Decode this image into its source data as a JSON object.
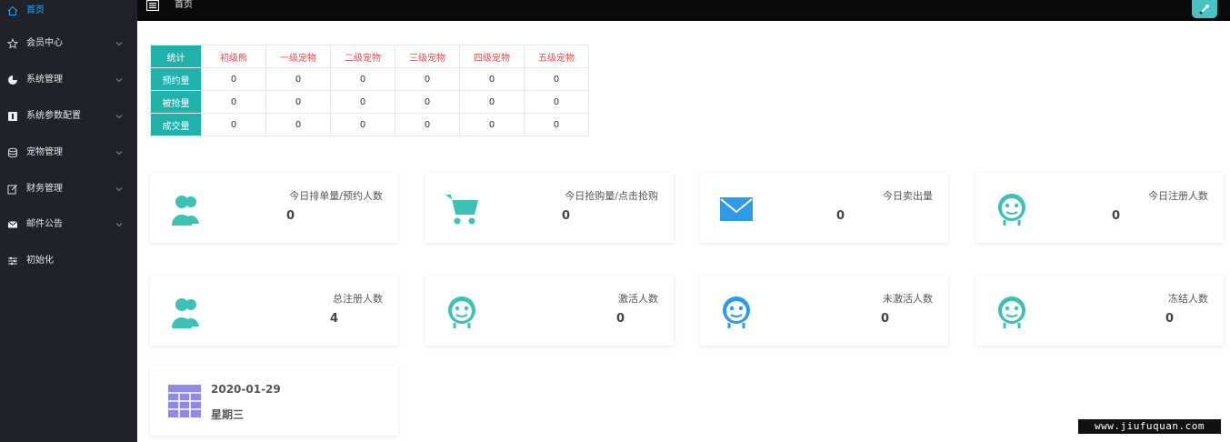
{
  "sidebar": {
    "items": [
      {
        "label": "首页",
        "icon": "home-icon",
        "has_children": false,
        "active": true
      },
      {
        "label": "会员中心",
        "icon": "star-icon",
        "has_children": true
      },
      {
        "label": "系统管理",
        "icon": "gear-icon",
        "has_children": true
      },
      {
        "label": "系统参数配置",
        "icon": "info-icon",
        "has_children": true
      },
      {
        "label": "宠物管理",
        "icon": "database-icon",
        "has_children": true
      },
      {
        "label": "财务管理",
        "icon": "edit-icon",
        "has_children": true
      },
      {
        "label": "邮件公告",
        "icon": "mail-icon",
        "has_children": true
      },
      {
        "label": "初始化",
        "icon": "sliders-icon",
        "has_children": false
      }
    ]
  },
  "header": {
    "breadcrumb": "首页",
    "menu_icon": "menu-icon",
    "avatar_icon": "avatar-icon"
  },
  "stats_table": {
    "corner": "统计",
    "columns": [
      "初级熊",
      "一级宠物",
      "二级宠物",
      "三级宠物",
      "四级宠物",
      "五级宠物"
    ],
    "rows": [
      {
        "label": "预约量",
        "values": [
          "0",
          "0",
          "0",
          "0",
          "0",
          "0"
        ]
      },
      {
        "label": "被抢量",
        "values": [
          "0",
          "0",
          "0",
          "0",
          "0",
          "0"
        ]
      },
      {
        "label": "成交量",
        "values": [
          "0",
          "0",
          "0",
          "0",
          "0",
          "0"
        ]
      }
    ]
  },
  "cards": [
    {
      "label": "今日排单量/预约人数",
      "value": "0",
      "icon": "users-icon",
      "color": "#3cc1b6"
    },
    {
      "label": "今日抢购量/点击抢购",
      "value": "0",
      "icon": "cart-icon",
      "color": "#3cc1b6"
    },
    {
      "label": "今日卖出量",
      "value": "0",
      "icon": "mail-icon",
      "color": "#2e9bea"
    },
    {
      "label": "今日注册人数",
      "value": "0",
      "icon": "robot-face-icon",
      "color": "#3cc1b6"
    },
    {
      "label": "总注册人数",
      "value": "4",
      "icon": "users-icon",
      "color": "#3cc1b6"
    },
    {
      "label": "激活人数",
      "value": "0",
      "icon": "robot-face-icon",
      "color": "#3cc1b6"
    },
    {
      "label": "未激活人数",
      "value": "0",
      "icon": "robot-face-icon",
      "color": "#2e9bea"
    },
    {
      "label": "冻结人数",
      "value": "0",
      "icon": "robot-face-icon",
      "color": "#3cc1b6"
    }
  ],
  "date_card": {
    "date": "2020-01-29",
    "weekday": "星期三",
    "icon": "calendar-grid-icon",
    "color": "#8f88e8"
  },
  "watermark": "www.jiufuquan.com",
  "colors": {
    "sidebar_bg": "#20222a",
    "accent": "#20b2aa",
    "active_nav": "#2ea8ff",
    "column_header": "#e04b4b"
  }
}
